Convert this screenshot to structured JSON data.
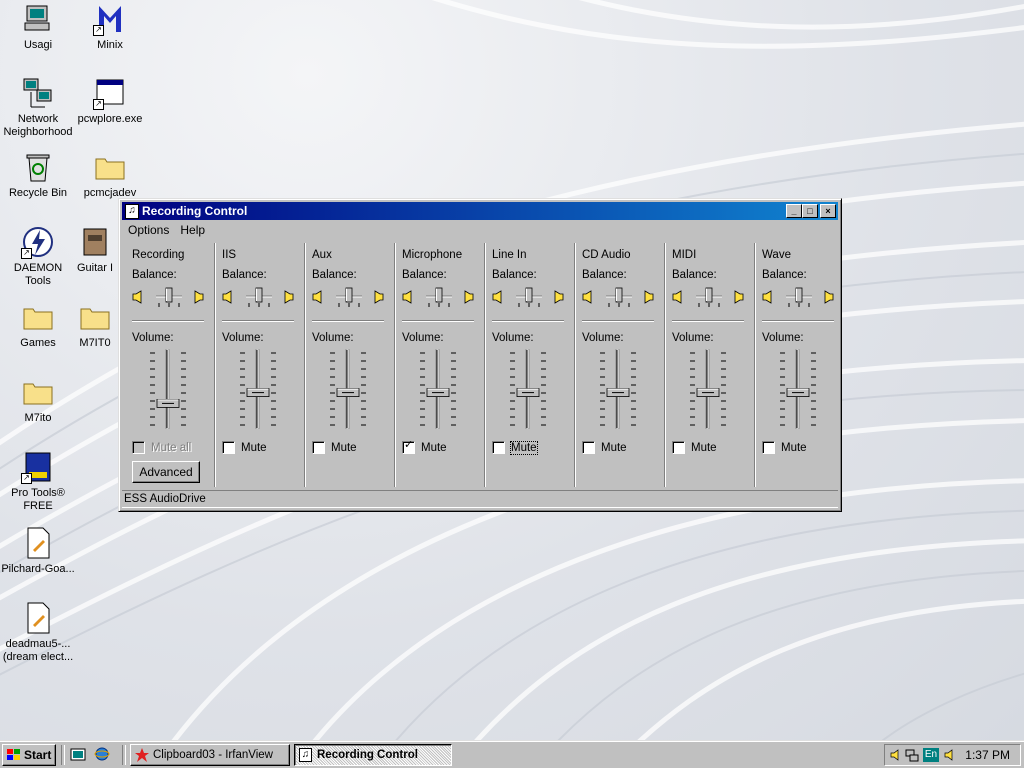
{
  "desktop": {
    "icons": [
      {
        "label": "Usagi",
        "icon": "computer-icon"
      },
      {
        "label": "Minix",
        "icon": "minix-icon"
      },
      {
        "label": "Network Neighborhood",
        "icon": "network-icon"
      },
      {
        "label": "pcwplore.exe",
        "icon": "application-icon"
      },
      {
        "label": "Recycle Bin",
        "icon": "recycle-bin-icon"
      },
      {
        "label": "pcmcjadev",
        "icon": "folder-icon"
      },
      {
        "label": "DAEMON Tools",
        "icon": "daemon-tools-icon"
      },
      {
        "label": "Guitar I",
        "icon": "guitar-icon"
      },
      {
        "label": "Games",
        "icon": "folder-icon"
      },
      {
        "label": "M7IT0",
        "icon": "folder-icon"
      },
      {
        "label": "M7ito",
        "icon": "folder-icon"
      },
      {
        "label": "Pro Tools® FREE",
        "icon": "pro-tools-icon"
      },
      {
        "label": "Pilchard-Goa...",
        "icon": "document-icon"
      },
      {
        "label": "deadmau5-... (dream elect...",
        "icon": "document-icon"
      }
    ]
  },
  "window": {
    "title": "Recording Control",
    "menu": [
      "Options",
      "Help"
    ],
    "status": "ESS AudioDrive",
    "columns": [
      {
        "name": "Recording",
        "balance_label": "Balance:",
        "volume_label": "Volume:",
        "mute_label": "Mute all",
        "muted": false,
        "disabled": true,
        "volume_level": 0.3,
        "balance": 0.5
      },
      {
        "name": "IIS",
        "balance_label": "Balance:",
        "volume_label": "Volume:",
        "mute_label": "Mute",
        "muted": false,
        "volume_level": 0.45,
        "balance": 0.5
      },
      {
        "name": "Aux",
        "balance_label": "Balance:",
        "volume_label": "Volume:",
        "mute_label": "Mute",
        "muted": false,
        "volume_level": 0.45,
        "balance": 0.5
      },
      {
        "name": "Microphone",
        "balance_label": "Balance:",
        "volume_label": "Volume:",
        "mute_label": "Mute",
        "muted": true,
        "volume_level": 0.45,
        "balance": 0.5
      },
      {
        "name": "Line In",
        "balance_label": "Balance:",
        "volume_label": "Volume:",
        "mute_label": "Mute",
        "muted": false,
        "focused": true,
        "volume_level": 0.45,
        "balance": 0.5
      },
      {
        "name": "CD Audio",
        "balance_label": "Balance:",
        "volume_label": "Volume:",
        "mute_label": "Mute",
        "muted": false,
        "volume_level": 0.45,
        "balance": 0.5
      },
      {
        "name": "MIDI",
        "balance_label": "Balance:",
        "volume_label": "Volume:",
        "mute_label": "Mute",
        "muted": false,
        "volume_level": 0.45,
        "balance": 0.5
      },
      {
        "name": "Wave",
        "balance_label": "Balance:",
        "volume_label": "Volume:",
        "mute_label": "Mute",
        "muted": false,
        "volume_level": 0.45,
        "balance": 0.5
      }
    ],
    "advanced_label": "Advanced"
  },
  "taskbar": {
    "start_label": "Start",
    "tasks": [
      {
        "label": "Clipboard03 - IrfanView",
        "icon": "irfanview-icon",
        "active": false
      },
      {
        "label": "Recording Control",
        "icon": "mixer-icon",
        "active": true
      }
    ],
    "language": "En",
    "clock": "1:37 PM"
  }
}
